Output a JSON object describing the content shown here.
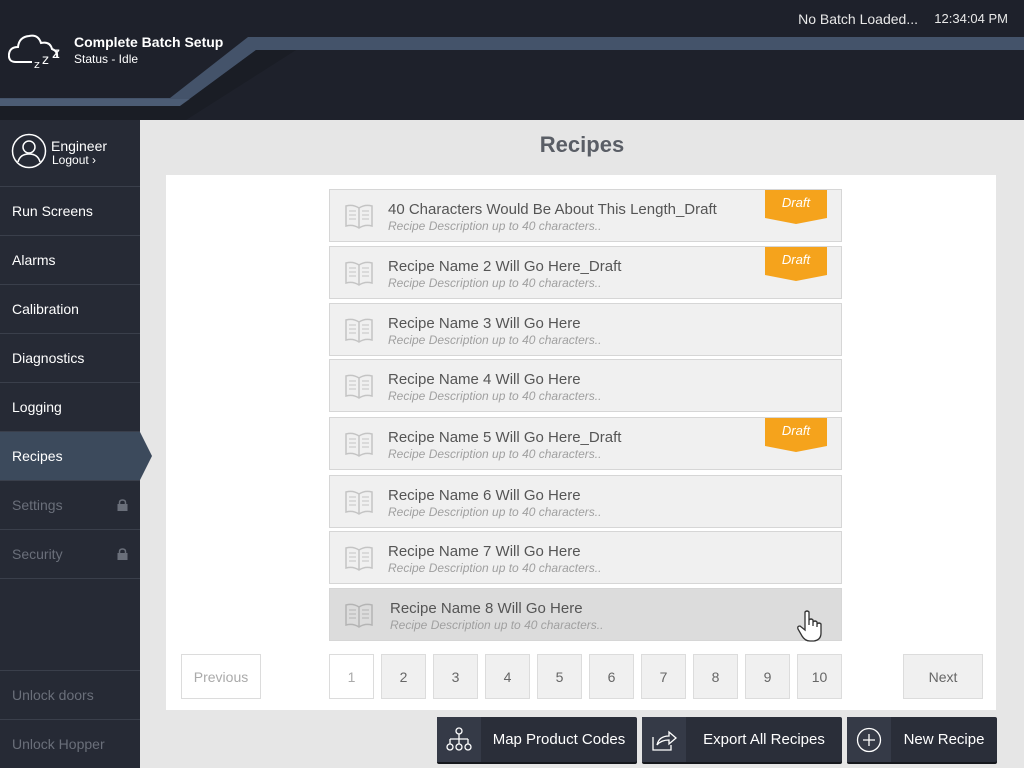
{
  "header": {
    "app_title": "Complete Batch Setup",
    "status": "Status - Idle",
    "batch_status": "No Batch Loaded...",
    "clock": "12:34:04 PM"
  },
  "sidebar": {
    "user": {
      "name": "Engineer",
      "logout_label": "Logout"
    },
    "items": [
      {
        "label": "Run Screens",
        "locked": false,
        "active": false
      },
      {
        "label": "Alarms",
        "locked": false,
        "active": false
      },
      {
        "label": "Calibration",
        "locked": false,
        "active": false
      },
      {
        "label": "Diagnostics",
        "locked": false,
        "active": false
      },
      {
        "label": "Logging",
        "locked": false,
        "active": false
      },
      {
        "label": "Recipes",
        "locked": false,
        "active": true
      },
      {
        "label": "Settings",
        "locked": true,
        "active": false
      },
      {
        "label": "Security",
        "locked": true,
        "active": false
      }
    ],
    "actions": [
      {
        "label": "Unlock doors"
      },
      {
        "label": "Unlock Hopper"
      }
    ]
  },
  "main": {
    "title": "Recipes",
    "draft_label": "Draft",
    "recipes": [
      {
        "name": "40 Characters Would Be About This Length_Draft",
        "description": "Recipe Description up to 40 characters..",
        "draft": true
      },
      {
        "name": "Recipe Name 2 Will Go Here_Draft",
        "description": "Recipe Description up to 40 characters..",
        "draft": true
      },
      {
        "name": "Recipe Name 3 Will Go Here",
        "description": "Recipe Description up to 40 characters..",
        "draft": false
      },
      {
        "name": "Recipe Name 4 Will Go Here",
        "description": "Recipe Description up to 40 characters..",
        "draft": false
      },
      {
        "name": "Recipe Name 5 Will Go Here_Draft",
        "description": "Recipe Description up to 40 characters..",
        "draft": true
      },
      {
        "name": "Recipe Name 6 Will Go Here",
        "description": "Recipe Description up to 40 characters..",
        "draft": false
      },
      {
        "name": "Recipe Name 7 Will Go Here",
        "description": "Recipe Description up to 40 characters..",
        "draft": false
      },
      {
        "name": "Recipe Name 8 Will Go Here",
        "description": "Recipe Description up to 40 characters..",
        "draft": false
      }
    ],
    "pagination": {
      "previous_label": "Previous",
      "next_label": "Next",
      "pages": [
        "1",
        "2",
        "3",
        "4",
        "5",
        "6",
        "7",
        "8",
        "9",
        "10"
      ],
      "current": "1"
    }
  },
  "footer": {
    "map_product_codes": "Map Product Codes",
    "export_all_recipes": "Export All Recipes",
    "new_recipe": "New Recipe"
  },
  "colors": {
    "header_bg": "#1e212b",
    "sidebar_bg": "#262a35",
    "active_nav": "#3c4a5c",
    "draft_badge": "#f5a31c",
    "stripe": "#44536a"
  },
  "icons": {
    "logo": "sleeping-cloud-icon",
    "user": "user-avatar-icon",
    "recipe": "book-icon",
    "lock": "lock-icon",
    "map": "hierarchy-icon",
    "export": "share-arrow-icon",
    "new": "plus-circle-icon",
    "cursor": "hand-pointer-icon"
  }
}
